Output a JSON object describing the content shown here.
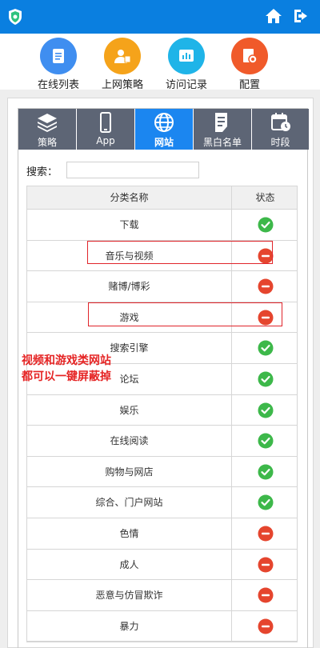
{
  "nav": {
    "items": [
      {
        "label": "在线列表"
      },
      {
        "label": "上网策略"
      },
      {
        "label": "访问记录"
      },
      {
        "label": "配置"
      }
    ]
  },
  "tabs": [
    {
      "label": "策略"
    },
    {
      "label": "App"
    },
    {
      "label": "网站"
    },
    {
      "label": "黑白名单"
    },
    {
      "label": "时段"
    }
  ],
  "search": {
    "label": "搜索：",
    "value": ""
  },
  "table": {
    "headers": [
      "分类名称",
      "状态"
    ],
    "rows": [
      {
        "name": "下载",
        "status": "allowed"
      },
      {
        "name": "音乐与视频",
        "status": "blocked"
      },
      {
        "name": "赌博/博彩",
        "status": "blocked"
      },
      {
        "name": "游戏",
        "status": "blocked"
      },
      {
        "name": "搜索引擎",
        "status": "allowed"
      },
      {
        "name": "论坛",
        "status": "allowed"
      },
      {
        "name": "娱乐",
        "status": "allowed"
      },
      {
        "name": "在线阅读",
        "status": "allowed"
      },
      {
        "name": "购物与网店",
        "status": "allowed"
      },
      {
        "name": "综合、门户网站",
        "status": "allowed"
      },
      {
        "name": "色情",
        "status": "blocked"
      },
      {
        "name": "成人",
        "status": "blocked"
      },
      {
        "name": "恶意与仿冒欺诈",
        "status": "blocked"
      },
      {
        "name": "暴力",
        "status": "blocked"
      }
    ]
  },
  "annotation": {
    "line1": "视频和游戏类网站",
    "line2": "都可以一键屏蔽掉"
  },
  "colors": {
    "topbar": "#0a7fe0",
    "tab_active": "#1b86f0",
    "tab_inactive": "#5d6575",
    "allowed": "#3db84a",
    "blocked": "#e5452e",
    "highlight": "#e0242b"
  }
}
